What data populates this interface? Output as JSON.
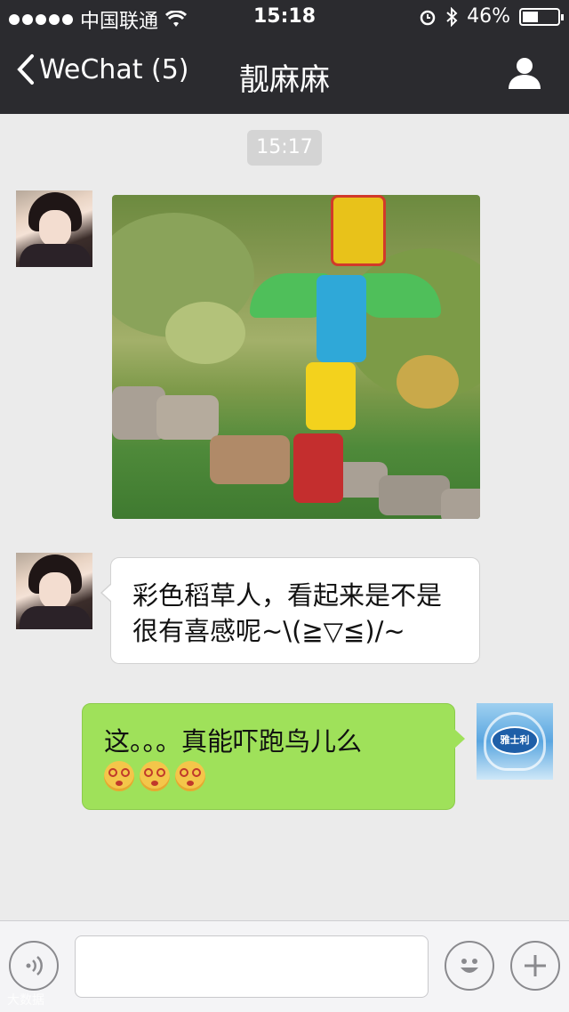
{
  "status_bar": {
    "carrier": "中国联通",
    "time": "15:18",
    "battery": "46%",
    "battery_level": 0.46
  },
  "nav": {
    "back_label": "WeChat (5)",
    "title": "靓麻麻"
  },
  "chat": {
    "timestamp": "15:17",
    "messages": [
      {
        "from": "contact",
        "type": "image",
        "image_desc": "colorful totem-pole scarecrow made of painted cans in a garden"
      },
      {
        "from": "contact",
        "type": "text",
        "text": "彩色稻草人，看起来是不是很有喜感呢~\\(≧▽≦)/~"
      },
      {
        "from": "me",
        "type": "text",
        "text": "这。。。真能吓跑鸟儿么",
        "emoji": [
          "dizzy-face",
          "dizzy-face",
          "dizzy-face"
        ]
      }
    ],
    "my_avatar_text": "雅士利"
  },
  "input": {
    "value": "",
    "placeholder": ""
  },
  "watermark": "大数据"
}
